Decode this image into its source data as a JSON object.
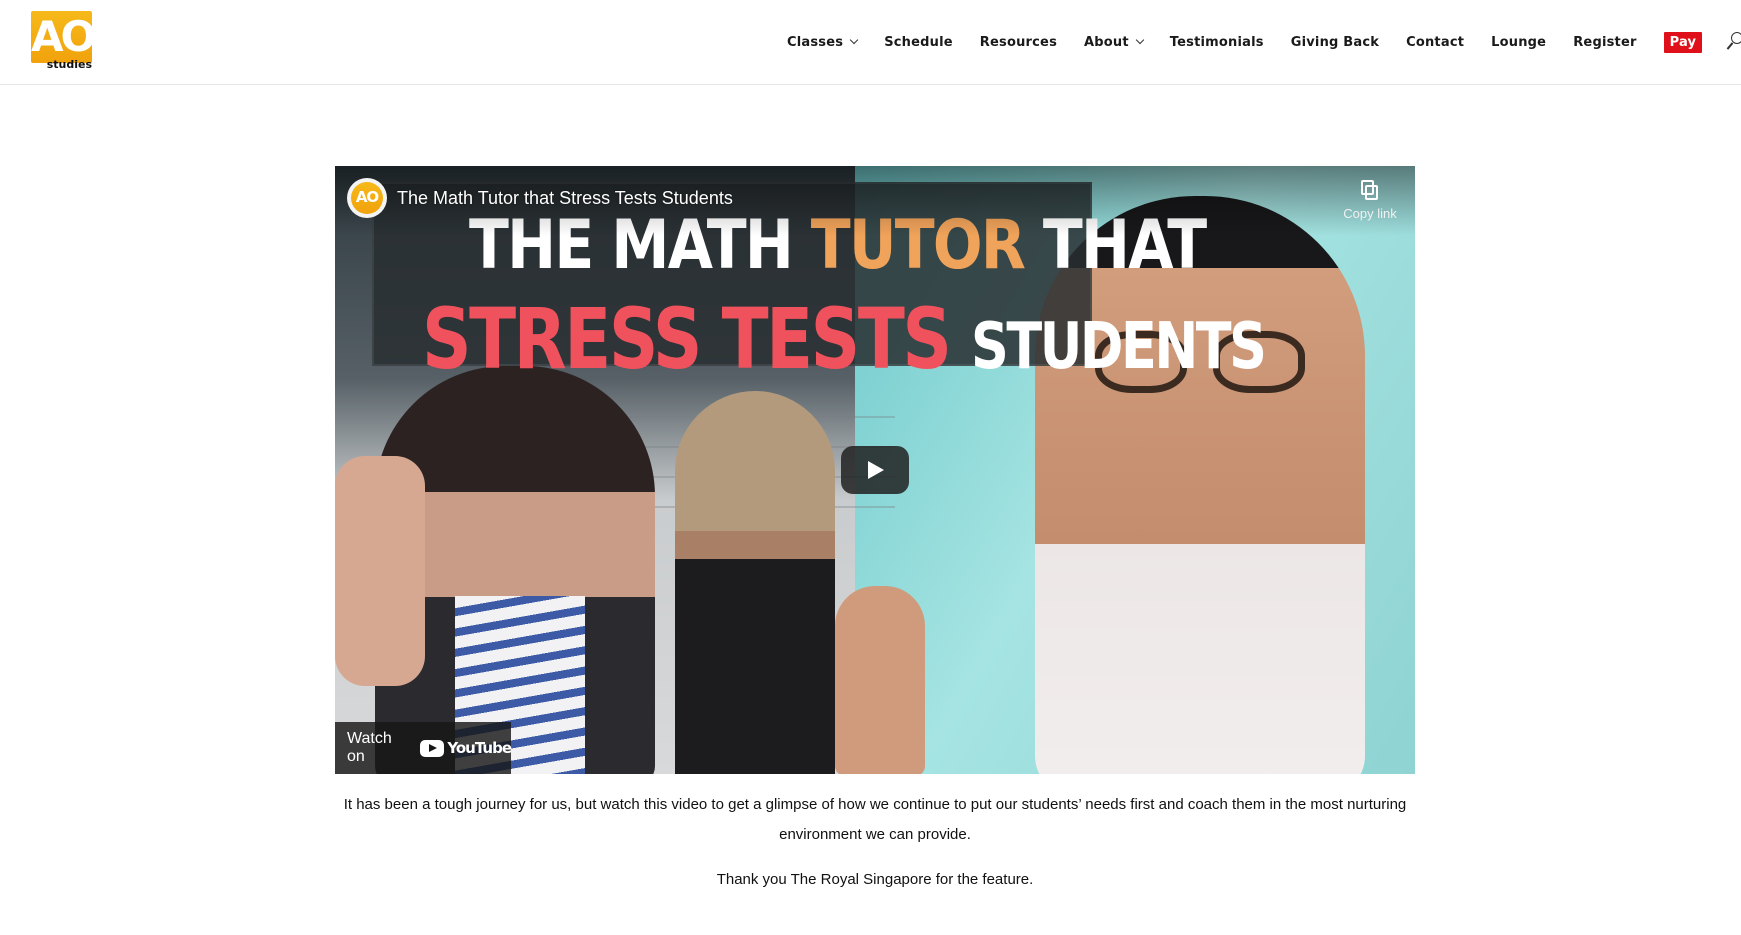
{
  "logo": {
    "letters": "AO",
    "subtext": "studies"
  },
  "nav": {
    "items": [
      {
        "label": "Classes",
        "has_dropdown": true
      },
      {
        "label": "Schedule",
        "has_dropdown": false
      },
      {
        "label": "Resources",
        "has_dropdown": false
      },
      {
        "label": "About",
        "has_dropdown": true
      },
      {
        "label": "Testimonials",
        "has_dropdown": false
      },
      {
        "label": "Giving Back",
        "has_dropdown": false
      },
      {
        "label": "Contact",
        "has_dropdown": false
      },
      {
        "label": "Lounge",
        "has_dropdown": false
      },
      {
        "label": "Register",
        "has_dropdown": false
      }
    ],
    "pay_label": "Pay",
    "pay_color": "#e0101b",
    "search_icon": "search-icon"
  },
  "video": {
    "title": "The Math Tutor that Stress Tests Students",
    "channel_avatar": "AO",
    "copy_link_label": "Copy link",
    "thumbnail": {
      "line1_a": "THE MATH ",
      "line1_b": "TUTOR",
      "line1_c": " THAT",
      "line2_a": "STRESS TESTS ",
      "line2_b": "STUDENTS"
    },
    "watch_on_label": "Watch on",
    "youtube_label": "YouTube",
    "play_icon": "play-icon"
  },
  "content": {
    "caption": "It has been a tough journey for us, but watch this video to get a glimpse of how we continue to put our students’ needs first and coach them in the most nurturing environment we can provide.",
    "thanks": "Thank you The Royal Singapore for the feature."
  },
  "colors": {
    "brand": "#f1a20c",
    "accent_red": "#e0101b"
  }
}
